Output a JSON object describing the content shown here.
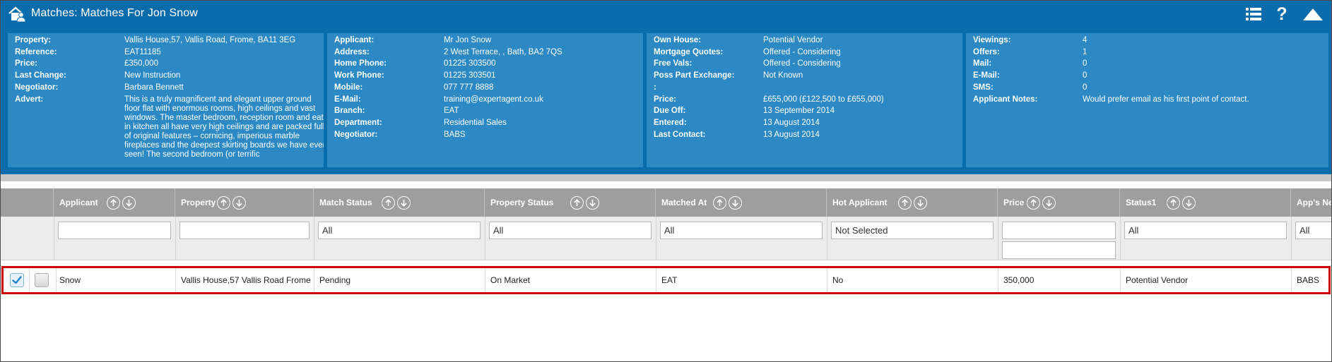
{
  "window": {
    "title": "Matches: Matches For Jon Snow"
  },
  "property_panel": [
    {
      "label": "Property:",
      "value": "Vallis House,57, Vallis Road, Frome, BA11 3EG"
    },
    {
      "label": "Reference:",
      "value": "EAT11185"
    },
    {
      "label": "Price:",
      "value": "£350,000"
    },
    {
      "label": "Last Change:",
      "value": "New Instruction"
    },
    {
      "label": "Negotiator:",
      "value": "Barbara Bennett"
    }
  ],
  "advert": {
    "label": "Advert:",
    "value": "This is a truly magnificent and elegant upper ground floor flat with enormous rooms, high ceilings and vast windows. The master bedroom, reception room and eat-in kitchen all have very high ceilings and are packed full of original features – cornicing, imperious marble fireplaces and the deepest skirting boards we have ever seen! The second bedroom (or terrific"
  },
  "applicant_panel": [
    {
      "label": "Applicant:",
      "value": "Mr Jon Snow"
    },
    {
      "label": "Address:",
      "value": "2 West Terrace, , Bath, BA2 7QS"
    },
    {
      "label": "Home Phone:",
      "value": "01225 303500"
    },
    {
      "label": "Work Phone:",
      "value": "01225 303501"
    },
    {
      "label": "Mobile:",
      "value": "077 777 8888"
    },
    {
      "label": "E-Mail:",
      "value": "training@expertagent.co.uk"
    },
    {
      "label": "Branch:",
      "value": "EAT"
    },
    {
      "label": "Department:",
      "value": "Residential Sales"
    },
    {
      "label": "Negotiator:",
      "value": "BABS"
    }
  ],
  "status_panel": [
    {
      "label": "Own House:",
      "value": "Potential Vendor"
    },
    {
      "label": "Mortgage Quotes:",
      "value": "Offered - Considering"
    },
    {
      "label": "Free Vals:",
      "value": "Offered - Considering"
    },
    {
      "label": "Poss Part Exchange:",
      "value": "Not Known"
    },
    {
      "label": ":",
      "value": ""
    },
    {
      "label": "Price:",
      "value": "£655,000 (£122,500 to £655,000)"
    },
    {
      "label": "Due Off:",
      "value": "13 September 2014"
    },
    {
      "label": "Entered:",
      "value": "13 August 2014"
    },
    {
      "label": "Last Contact:",
      "value": "13 August 2014"
    }
  ],
  "stats_panel": [
    {
      "label": "Viewings:",
      "value": "4"
    },
    {
      "label": "Offers:",
      "value": "1"
    },
    {
      "label": "Mail:",
      "value": "0"
    },
    {
      "label": "E-Mail:",
      "value": "0"
    },
    {
      "label": "SMS:",
      "value": "0"
    },
    {
      "label": "Applicant Notes:",
      "value": "Would prefer email as his first point of contact."
    }
  ],
  "grid": {
    "columns": [
      {
        "label": "Applicant",
        "filter": ""
      },
      {
        "label": "Property",
        "filter": ""
      },
      {
        "label": "Match Status",
        "filter": "All"
      },
      {
        "label": "Property Status",
        "filter": "All"
      },
      {
        "label": "Matched At",
        "filter": "All"
      },
      {
        "label": "Hot Applicant",
        "filter": "Not Selected"
      },
      {
        "label": "Price",
        "filter": "",
        "filter2": ""
      },
      {
        "label": "Status1",
        "filter": "All"
      },
      {
        "label": "App's Ne",
        "filter": "All"
      }
    ],
    "rows": [
      {
        "selected": true,
        "cells": [
          "Snow",
          "Vallis House,57 Vallis Road Frome",
          "Pending",
          "On Market",
          "EAT",
          "No",
          "350,000",
          "Potential Vendor",
          "BABS"
        ]
      }
    ]
  },
  "icons": {
    "home": "home-user-icon",
    "list": "list-view-icon",
    "help": "help-icon",
    "collapse": "collapse-up-icon",
    "sort_up": "sort-ascending-icon",
    "sort_down": "sort-descending-icon",
    "check": "checkmark-icon"
  },
  "colors": {
    "header": "#0a6cab",
    "panel": "#2c89c3",
    "grid_header": "#9e9e9e",
    "selection_border": "#cc0000"
  }
}
